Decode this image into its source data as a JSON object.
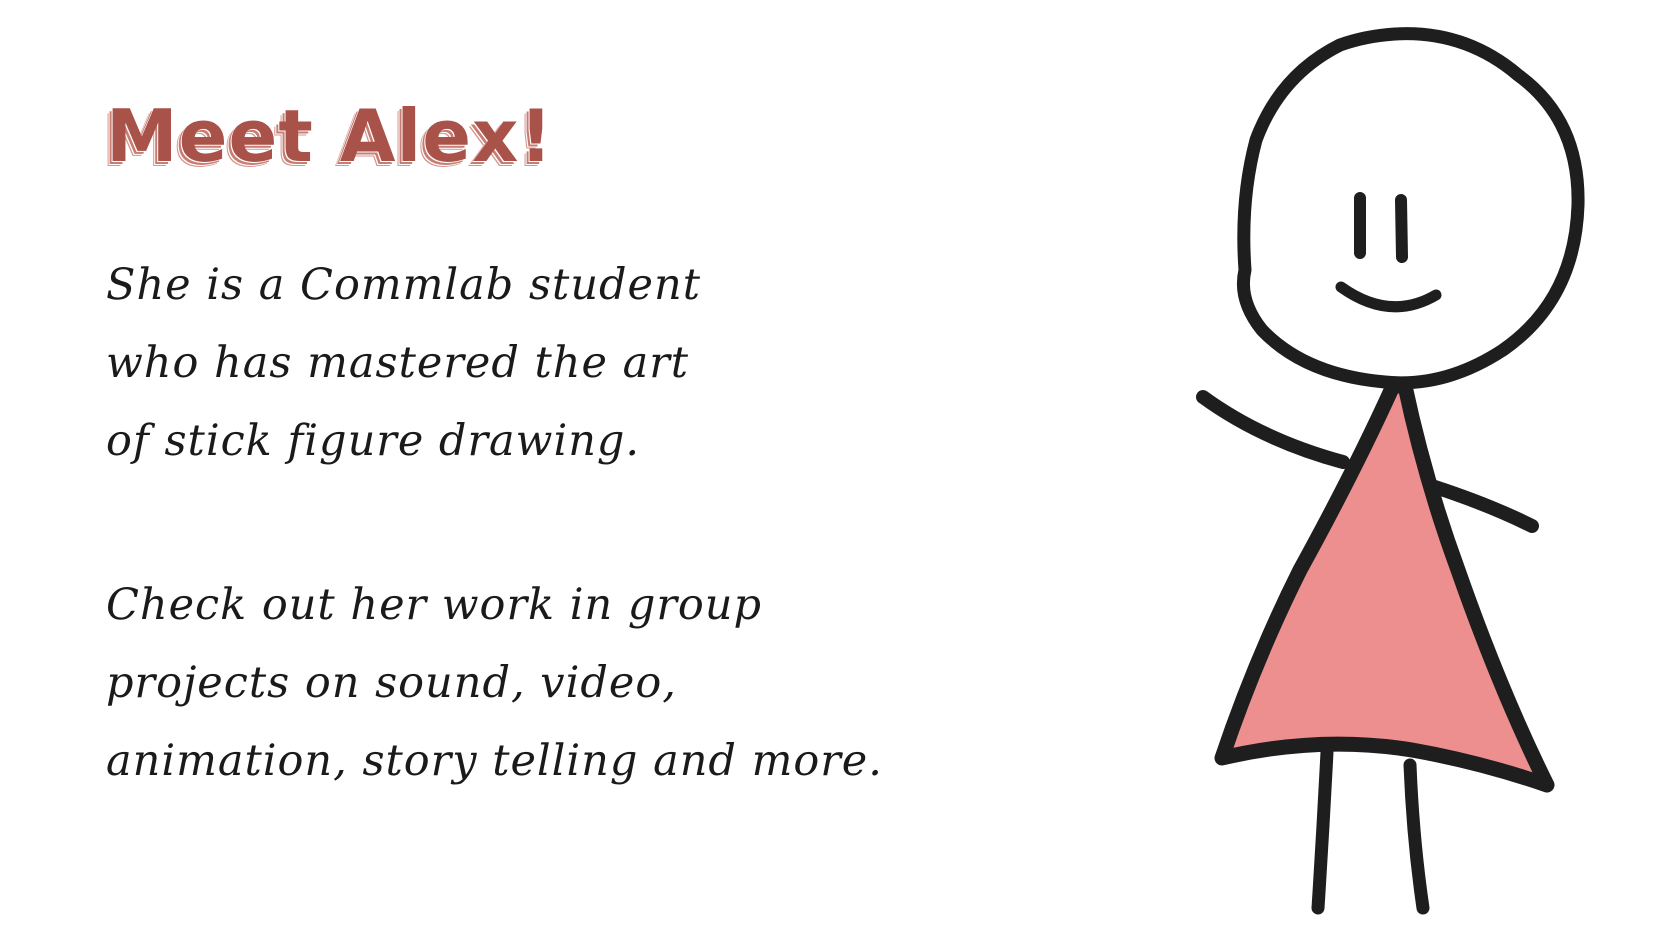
{
  "title": "Meet Alex!",
  "intro_lines": [
    "She is a Commlab student",
    "who has mastered the art",
    "of stick figure drawing."
  ],
  "work_lines": [
    "Check out her work in group",
    "projects on sound, video,",
    "animation, story telling and more."
  ],
  "colors": {
    "title": "#a8524a",
    "title_shadow": "#c97c72",
    "dress": "#ee8f8f",
    "outline": "#1e1e1e",
    "text": "#1a1a1a"
  },
  "illustration": "stick-figure-girl-in-pink-dress-waving"
}
